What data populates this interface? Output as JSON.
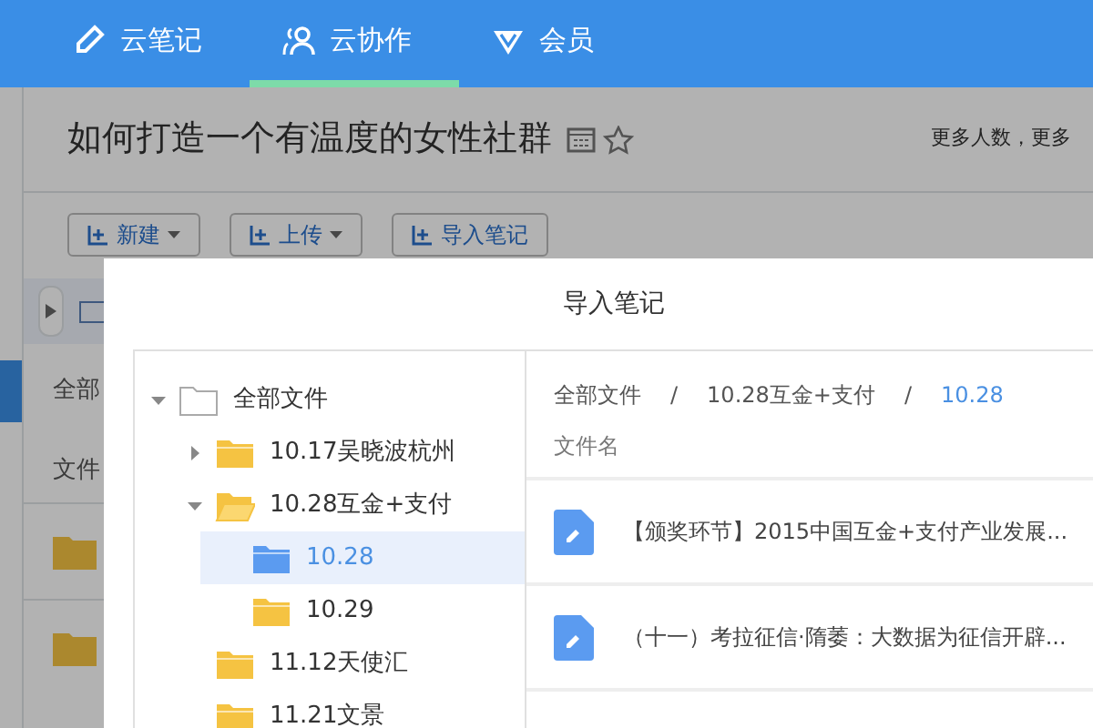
{
  "nav": {
    "tabs": [
      {
        "label": "云笔记",
        "selected": false
      },
      {
        "label": "云协作",
        "selected": true
      },
      {
        "label": "会员",
        "selected": false
      }
    ]
  },
  "page": {
    "title": "如何打造一个有温度的女性社群",
    "aside": "更多人数，更多",
    "toolbar": [
      {
        "label": "新建",
        "dropdown": true
      },
      {
        "label": "上传",
        "dropdown": true
      },
      {
        "label": "导入笔记",
        "dropdown": false
      }
    ],
    "crumb": "全部",
    "column": "文件"
  },
  "dialog": {
    "title": "导入笔记",
    "tree": [
      {
        "label": "全部文件",
        "kind": "root",
        "expanded": true,
        "selected": false,
        "children": [
          {
            "label": "10.17吴晓波杭州",
            "kind": "folder",
            "expanded": false,
            "selected": false
          },
          {
            "label": "10.28互金+支付",
            "kind": "folder",
            "expanded": true,
            "selected": false,
            "children": [
              {
                "label": "10.28",
                "kind": "folder",
                "selected": true
              },
              {
                "label": "10.29",
                "kind": "folder",
                "selected": false
              }
            ]
          },
          {
            "label": "11.12天使汇",
            "kind": "folder",
            "selected": false
          },
          {
            "label": "11.21文景",
            "kind": "folder",
            "selected": false
          }
        ]
      }
    ],
    "breadcrumb": [
      {
        "label": "全部文件",
        "current": false
      },
      {
        "separator": "/",
        "label": "10.28互金+支付",
        "current": false
      },
      {
        "separator": "/",
        "label": "10.28",
        "current": true
      }
    ],
    "column": "文件名",
    "files": [
      "【颁奖环节】2015中国互金+支付产业发展...",
      "（十一）考拉征信·隋萎：大数据为征信开辟..."
    ]
  }
}
